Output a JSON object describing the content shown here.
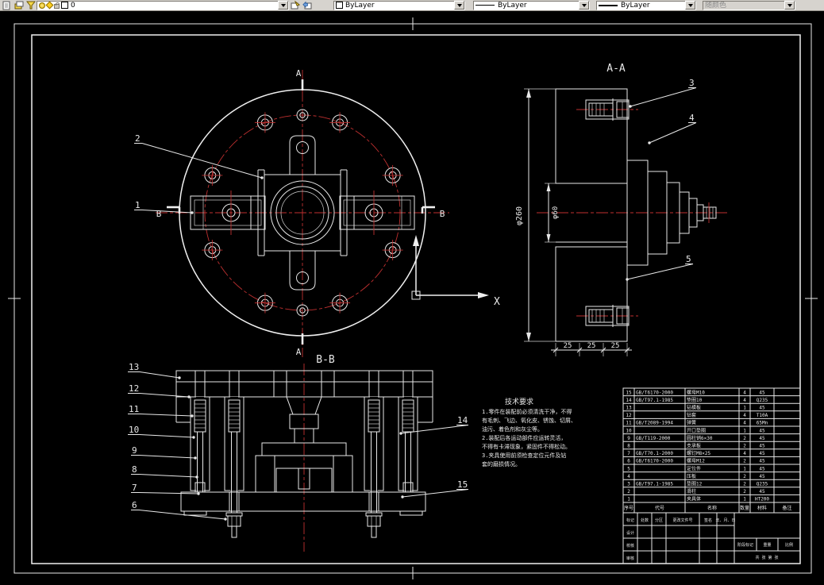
{
  "toolbar": {
    "layer_value": "0",
    "color_value": "ByLayer",
    "linetype_value": "ByLayer",
    "lineweight_value": "ByLayer",
    "plot_style_value": "随颜色"
  },
  "colors": {
    "canvas_bg": "#000000",
    "line": "#e8e8e8",
    "centerline": "#c03030",
    "toolbar_bg": "#d6d3ce"
  },
  "drawing": {
    "labels": {
      "section_aa_title": "A-A",
      "section_bb_title": "B-B",
      "cut_a": "A",
      "cut_b": "B",
      "ucs_x": "X",
      "dim_d260": "φ260",
      "dim_d60": "φ60",
      "dim_25": "25"
    },
    "callouts": [
      "1",
      "2",
      "3",
      "4",
      "5",
      "6",
      "7",
      "8",
      "9",
      "10",
      "11",
      "12",
      "13",
      "14",
      "15"
    ]
  },
  "notes": {
    "title": "技术要求",
    "lines": [
      "1.零件在装配前必须清洗干净，不得",
      "有毛刺、飞边、氧化皮、锈蚀、切屑、",
      "油污、着色剂和灰尘等。",
      "2.装配后各运动部件应运转灵活，",
      "不得有卡滞现象，紧固件不得松动。",
      "3.夹具使用前须检查定位元件及钻",
      "套的磨损情况。"
    ]
  },
  "bom": {
    "headers": [
      "序号",
      "代号",
      "名称",
      "数量",
      "材料",
      "备注"
    ],
    "rows": [
      [
        "15",
        "GB/T6170-2000",
        "螺母M10",
        "4",
        "45",
        ""
      ],
      [
        "14",
        "GB/T97.1-1985",
        "垫圈10",
        "4",
        "Q235",
        ""
      ],
      [
        "13",
        "",
        "钻模板",
        "1",
        "45",
        ""
      ],
      [
        "12",
        "",
        "钻套",
        "4",
        "T10A",
        ""
      ],
      [
        "11",
        "GB/T2089-1994",
        "弹簧",
        "4",
        "65Mn",
        ""
      ],
      [
        "10",
        "",
        "开口垫圈",
        "1",
        "45",
        ""
      ],
      [
        "9",
        "GB/T119-2000",
        "圆柱销6×30",
        "2",
        "45",
        ""
      ],
      [
        "8",
        "",
        "支承板",
        "2",
        "45",
        ""
      ],
      [
        "7",
        "GB/T70.1-2000",
        "螺钉M8×25",
        "4",
        "45",
        ""
      ],
      [
        "6",
        "GB/T6170-2000",
        "螺母M12",
        "2",
        "45",
        ""
      ],
      [
        "5",
        "",
        "定位件",
        "1",
        "45",
        ""
      ],
      [
        "4",
        "",
        "压板",
        "2",
        "45",
        ""
      ],
      [
        "3",
        "GB/T97.1-1985",
        "垫圈12",
        "2",
        "Q235",
        ""
      ],
      [
        "2",
        "",
        "滑柱",
        "2",
        "45",
        ""
      ],
      [
        "1",
        "",
        "夹具体",
        "1",
        "HT200",
        ""
      ]
    ]
  },
  "title_block": {
    "top_labels": [
      "标记",
      "处数",
      "分区",
      "更改文件号",
      "签名",
      "年、月、日"
    ],
    "left_rows": [
      "设计",
      "校核",
      "审核"
    ],
    "right_labels": [
      "阶段标记",
      "重量",
      "比例"
    ],
    "sheet_label": "共 张 第 张"
  }
}
